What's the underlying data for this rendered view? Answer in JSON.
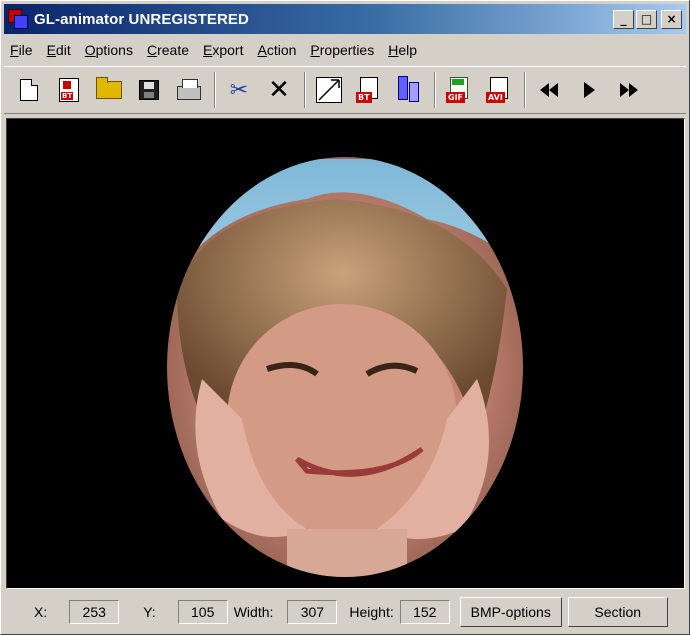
{
  "window": {
    "title": "GL-animator UNREGISTERED"
  },
  "title_buttons": {
    "minimize": "_",
    "maximize": "□",
    "close": "×"
  },
  "menu": [
    {
      "first": "F",
      "rest": "ile"
    },
    {
      "first": "E",
      "rest": "dit"
    },
    {
      "first": "O",
      "rest": "ptions"
    },
    {
      "first": "C",
      "rest": "reate"
    },
    {
      "first": "E",
      "rest": "xport"
    },
    {
      "first": "A",
      "rest": "ction"
    },
    {
      "first": "P",
      "rest": "roperties"
    },
    {
      "first": "H",
      "rest": "elp"
    }
  ],
  "toolbar": {
    "badge_open_doc": "BT",
    "badge_export_bt": "BT",
    "badge_gif": "GIF",
    "badge_avi": "AVI",
    "icons": [
      "new-document-icon",
      "open-bt-icon",
      "open-folder-icon",
      "save-disk-icon",
      "print-icon",
      "cut-scissors-icon",
      "delete-x-icon",
      "frame-icon",
      "export-bt-icon",
      "blue-bars-icon",
      "export-gif-icon",
      "export-avi-icon",
      "rewind-icon",
      "play-icon",
      "fast-forward-icon"
    ]
  },
  "status": {
    "x_label": "X:",
    "x_value": "253",
    "y_label": "Y:",
    "y_value": "105",
    "width_label": "Width:",
    "width_value": "307",
    "height_label": "Height:",
    "height_value": "152",
    "bmp_options": "BMP-options",
    "section": "Section"
  },
  "colors": {
    "face_bg": "#000000",
    "title_start": "#0a246a",
    "title_end": "#a6caf0",
    "chrome": "#d4d0c8"
  }
}
